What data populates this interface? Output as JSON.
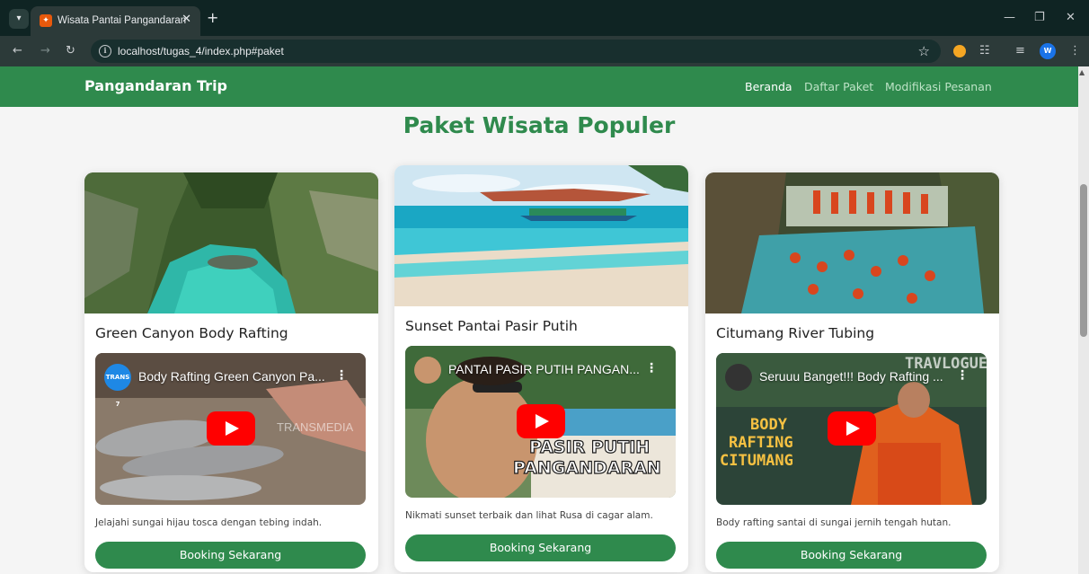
{
  "browser": {
    "tab_title": "Wisata Pantai Pangandaran",
    "url": "localhost/tugas_4/index.php#paket",
    "avatar_letter": "W"
  },
  "navbar": {
    "brand": "Pangandaran Trip",
    "links": [
      "Beranda",
      "Daftar Paket",
      "Modifikasi Pesanan"
    ],
    "active": "Beranda"
  },
  "section": {
    "title": "Paket Wisata Populer"
  },
  "cards": [
    {
      "title": "Green Canyon Body Rafting",
      "video": {
        "title": "Body Rafting Green Canyon Pa...",
        "watermark": "TRANSMEDIA",
        "channel_badge": "TRANS 7"
      },
      "description": "Jelajahi sungai hijau tosca dengan tebing indah.",
      "button": "Booking Sekarang"
    },
    {
      "title": "Sunset Pantai Pasir Putih",
      "video": {
        "title": "PANTAI PASIR PUTIH PANGAN...",
        "overlay_line1": "PASIR PUTIH",
        "overlay_line2": "PANGANDARAN"
      },
      "description": "Nikmati sunset terbaik dan lihat Rusa di cagar alam.",
      "button": "Booking Sekarang"
    },
    {
      "title": "Citumang River Tubing",
      "video": {
        "title": "Seruuu Banget!!! Body Rafting ...",
        "brand": "TRAVLOGUE",
        "overlay_line1": "BODY",
        "overlay_line2": "RAFTING",
        "overlay_line3": "CITUMANG"
      },
      "description": "Body rafting santai di sungai jernih tengah hutan.",
      "button": "Booking Sekarang"
    }
  ],
  "colors": {
    "primary": "#2f8a4d",
    "chrome": "#0f2423",
    "youtube": "#ff0000"
  }
}
